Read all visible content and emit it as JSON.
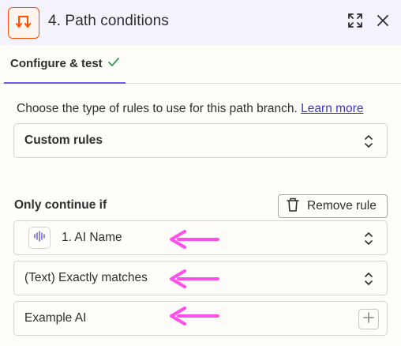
{
  "header": {
    "step_title": "4. Path conditions",
    "step_icon": "path-split-icon",
    "expand_icon": "expand-icon",
    "close_icon": "close-icon"
  },
  "tabs": [
    {
      "label": "Configure & test",
      "status_icon": "checkmark-icon",
      "active": true
    }
  ],
  "rule_type": {
    "description": "Choose the type of rules to use for this path branch.",
    "learn_more": "Learn more",
    "selected": "Custom rules"
  },
  "conditions": {
    "heading": "Only continue if",
    "remove_label": "Remove rule",
    "field": {
      "label": "1. AI Name",
      "app_icon": "audio-waveform-icon"
    },
    "operator": {
      "label": "(Text) Exactly matches"
    },
    "value": {
      "text": "Example AI"
    }
  },
  "colors": {
    "accent": "#ff4f00",
    "tab_underline": "#695be8",
    "link": "#3b37c9",
    "check": "#2e9e57",
    "annotation_arrow": "#ff4fea",
    "header_bg": "#f4f2fb",
    "page_bg": "#fffdf9"
  }
}
